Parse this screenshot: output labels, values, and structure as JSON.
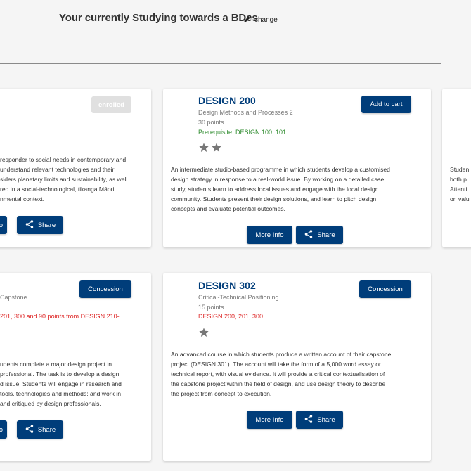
{
  "header": {
    "title": "Your currently Studying towards a BDes",
    "change_label": "change"
  },
  "cards": [
    {
      "enrolled_label": "enrolled",
      "desc_lines": [
        "responder to social needs in contemporary and",
        "understand relevant technologies and their",
        "siders planetary limits and sustainability, as well",
        "red in a social-technological, tikanga Māori,",
        "nmental context."
      ],
      "more_info_label": "fo",
      "share_label": "Share"
    },
    {
      "code": "DESIGN 200",
      "title": "Design Methods and Processes 2",
      "points": "30 points",
      "prerequisite": "Prerequisite: DESIGN 100, 101",
      "stars": 2,
      "action_label": "Add to cart",
      "desc_lines": [
        "An intermediate studio-based programme in which students develop a customised",
        "design strategy in response to a real-world issue. By working on a detailed case",
        "study, students learn to address local issues and engage with the local design",
        "community. Students present their design solutions, and learn to pitch design",
        "concepts and evaluate potential outcomes."
      ],
      "more_info_label": "More Info",
      "share_label": "Share"
    },
    {
      "desc_lines": [
        "Studen",
        "both p",
        "Attenti",
        "on valu"
      ]
    },
    {
      "title": "Capstone",
      "prerequisite": "201, 300 and 90 points from DESIGN 210-",
      "action_label": "Concession",
      "desc_lines": [
        "udents complete a major design project in",
        "professional. The task is to develop a design",
        "d issue. Students will engage in research and",
        "tools, technologies and methods; and work in",
        "and critiqued by design professionals."
      ],
      "more_info_label": "fo",
      "share_label": "Share"
    },
    {
      "code": "DESIGN 302",
      "title": "Critical-Technical Positioning",
      "points": "15 points",
      "prerequisite": "DESIGN 200, 201, 300",
      "stars": 1,
      "action_label": "Concession",
      "desc_lines": [
        "An advanced course in which students produce a written account of their capstone",
        "project (DESIGN 301). The account will take the form of a 5,000 word essay or",
        "technical report, with visual evidence. It will provide a critical contextualisation of",
        "the capstone project within the field of design, and use design theory to describe",
        "the project from concept to execution."
      ],
      "more_info_label": "More Info",
      "share_label": "Share"
    }
  ],
  "colors": {
    "primary": "#003d7a",
    "prereq_met": "#2e8b2e",
    "prereq_unmet": "#dd2222",
    "star": "#777777"
  },
  "icons": [
    "pencil-icon",
    "share-icon",
    "star-icon"
  ]
}
